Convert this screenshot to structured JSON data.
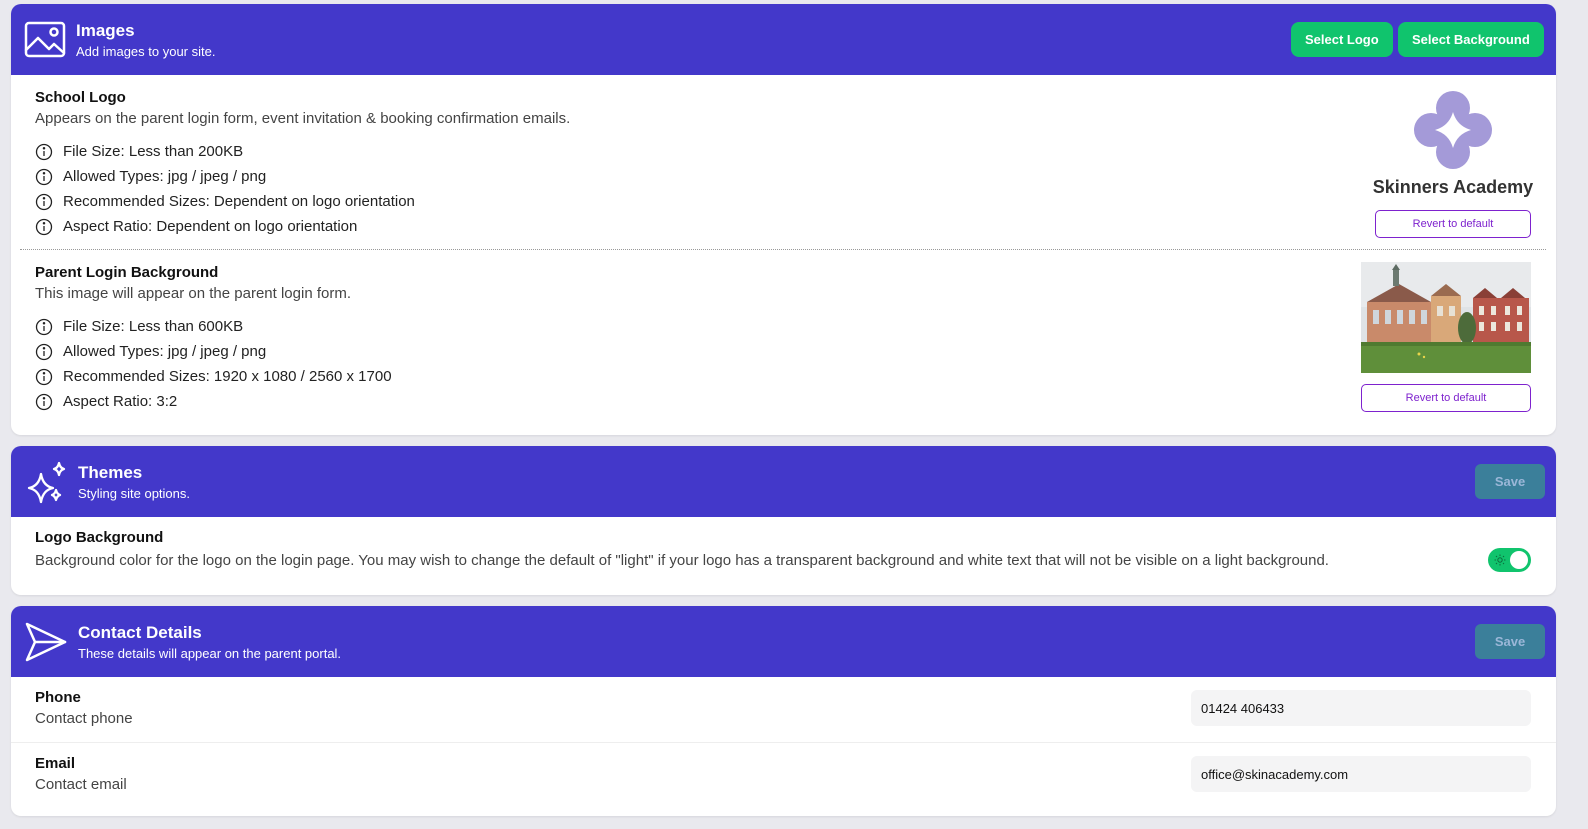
{
  "images": {
    "title": "Images",
    "subtitle": "Add images to your site.",
    "select_logo": "Select Logo",
    "select_background": "Select Background",
    "school_logo": {
      "title": "School Logo",
      "description": "Appears on the parent login form, event invitation & booking confirmation emails.",
      "info": [
        "File Size: Less than 200KB",
        "Allowed Types: jpg / jpeg / png",
        "Recommended Sizes: Dependent on logo orientation",
        "Aspect Ratio: Dependent on logo orientation"
      ],
      "preview_name": "Skinners Academy",
      "revert_label": "Revert to default"
    },
    "parent_bg": {
      "title": "Parent Login Background",
      "description": "This image will appear on the parent login form.",
      "info": [
        "File Size: Less than 600KB",
        "Allowed Types: jpg / jpeg / png",
        "Recommended Sizes: 1920 x 1080 / 2560 x 1700",
        "Aspect Ratio: 3:2"
      ],
      "revert_label": "Revert to default"
    }
  },
  "themes": {
    "title": "Themes",
    "subtitle": "Styling site options.",
    "save_label": "Save",
    "logo_background": {
      "title": "Logo Background",
      "description": "Background color for the logo on the login page. You may wish to change the default of \"light\" if your logo has a transparent background and white text that will not be visible on a light background."
    }
  },
  "contact": {
    "title": "Contact Details",
    "subtitle": "These details will appear on the parent portal.",
    "save_label": "Save",
    "phone": {
      "label": "Phone",
      "hint": "Contact phone",
      "value": "01424 406433"
    },
    "email": {
      "label": "Email",
      "hint": "Contact email",
      "value": "office@skinacademy.com"
    }
  },
  "colors": {
    "header": "#4338ca",
    "accent_green": "#10c46d",
    "save_button": "#3b7f9a",
    "outline_purple": "#7e22ce",
    "logo_purple": "#a49ad8"
  }
}
